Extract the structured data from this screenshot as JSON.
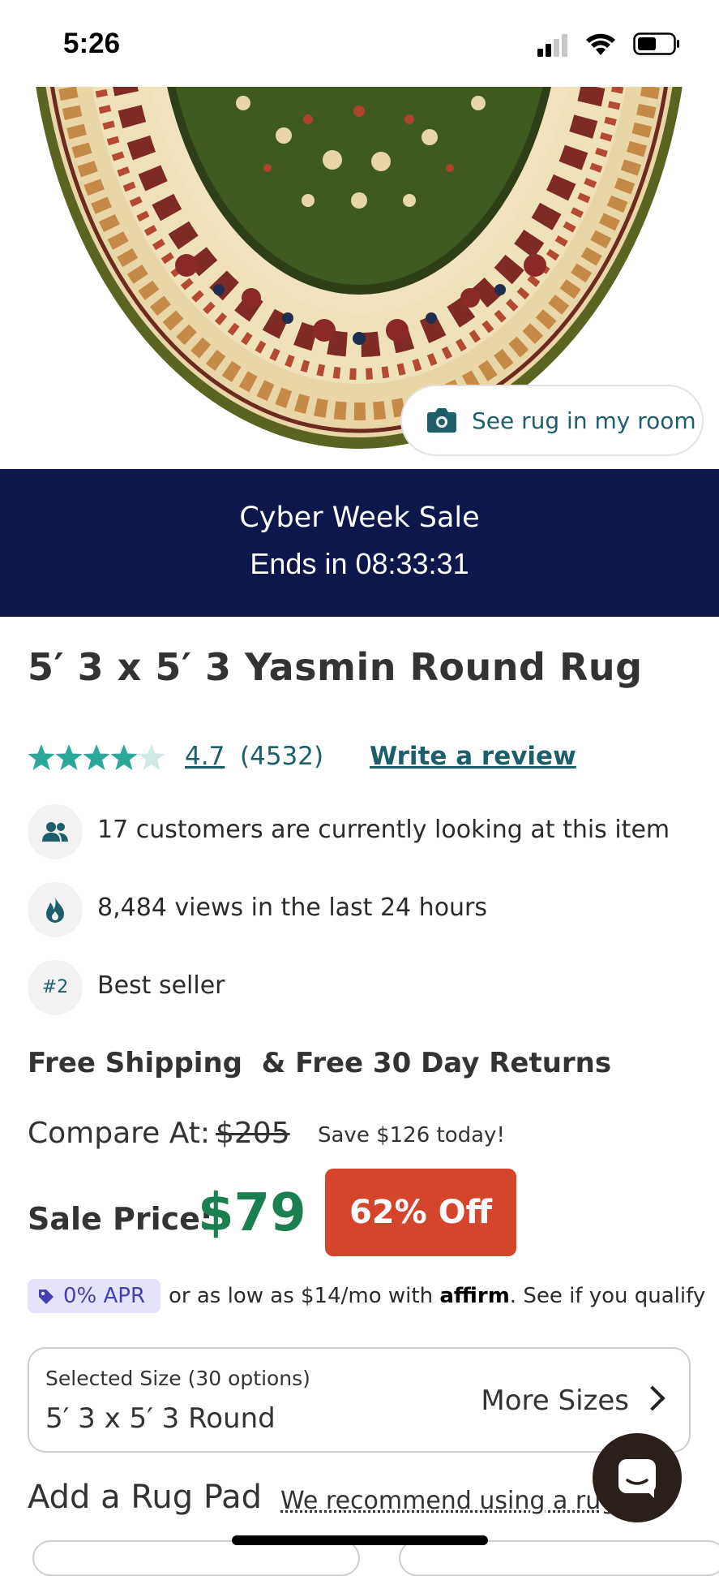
{
  "status_bar": {
    "time": "5:26"
  },
  "hero": {
    "room_button_label": "See rug in my room"
  },
  "sale_banner": {
    "title": "Cyber Week Sale",
    "timer": "Ends in 08:33:31",
    "background": "#0e174b"
  },
  "product": {
    "title": "5′ 3 x 5′ 3 Yasmin Round Rug",
    "rating": 4.7,
    "rating_text": "4.7",
    "review_count": "(4532)",
    "write_review": "Write a review",
    "stars_filled": 4.7
  },
  "info": [
    {
      "icon": "people-icon",
      "text": "17 customers are currently looking at this item"
    },
    {
      "icon": "flame-icon",
      "text": "8,484 views in the last 24 hours"
    },
    {
      "icon": "rank-badge",
      "badge": "#2",
      "text": "Best seller"
    }
  ],
  "shipping": "Free Shipping  & Free 30 Day Returns",
  "pricing": {
    "compare_label": "Compare At:",
    "compare_price": "$205",
    "save_text": "Save $126 today!",
    "sale_label": "Sale Price:",
    "sale_price": "$79",
    "discount": "62% Off",
    "sale_color": "#1b7f52",
    "badge_color": "#d4452c"
  },
  "financing": {
    "apr_label": "0% APR",
    "text_before": "or as low as $14/mo with ",
    "brand": "affirm",
    "text_after": ". See if you qualify"
  },
  "size_selector": {
    "caption": "Selected Size (30 options)",
    "value": "5′ 3 x 5′ 3 Round",
    "more_label": "More Sizes"
  },
  "rug_pad": {
    "title": "Add a Rug Pad",
    "link": "We recommend using a rug pad"
  },
  "colors": {
    "accent": "#1d5e6b",
    "star": "#2aa89a"
  }
}
